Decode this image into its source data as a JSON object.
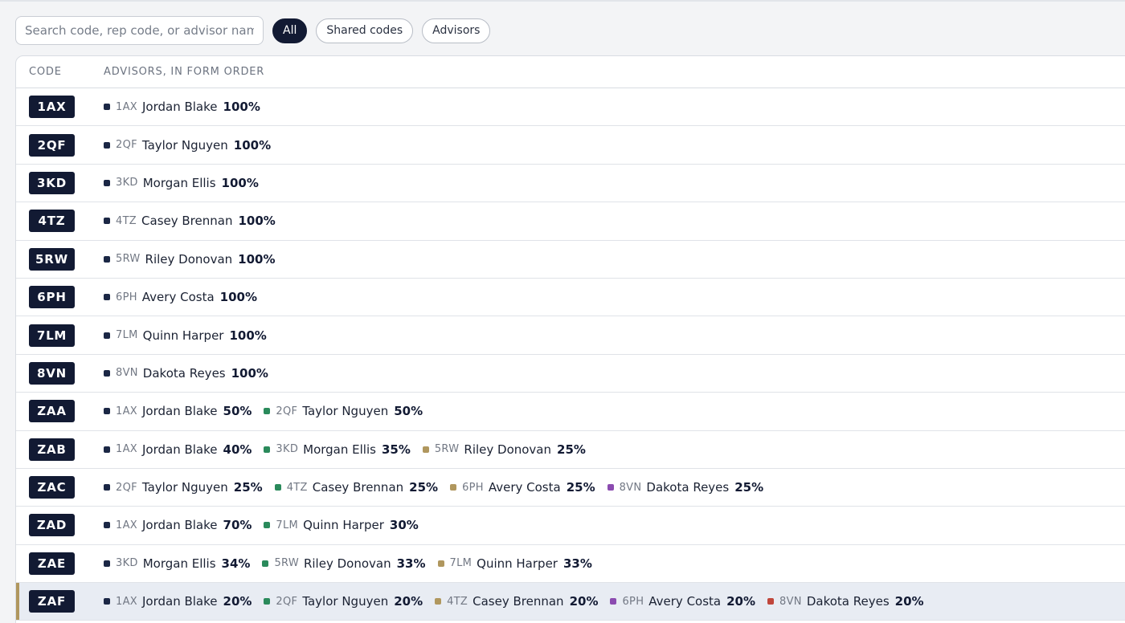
{
  "search": {
    "placeholder": "Search code, rep code, or advisor name"
  },
  "filters": [
    {
      "label": "All",
      "active": true
    },
    {
      "label": "Shared codes",
      "active": false
    },
    {
      "label": "Advisors",
      "active": false
    }
  ],
  "table": {
    "columns": [
      "CODE",
      "ADVISORS, IN FORM ORDER"
    ],
    "rows": [
      {
        "code": "1AX",
        "advisors": [
          {
            "rep": "1AX",
            "name": "Jordan Blake",
            "pct": "100%",
            "color": "#1b2745"
          }
        ]
      },
      {
        "code": "2QF",
        "advisors": [
          {
            "rep": "2QF",
            "name": "Taylor Nguyen",
            "pct": "100%",
            "color": "#1b2745"
          }
        ]
      },
      {
        "code": "3KD",
        "advisors": [
          {
            "rep": "3KD",
            "name": "Morgan Ellis",
            "pct": "100%",
            "color": "#1b2745"
          }
        ]
      },
      {
        "code": "4TZ",
        "advisors": [
          {
            "rep": "4TZ",
            "name": "Casey Brennan",
            "pct": "100%",
            "color": "#1b2745"
          }
        ]
      },
      {
        "code": "5RW",
        "advisors": [
          {
            "rep": "5RW",
            "name": "Riley Donovan",
            "pct": "100%",
            "color": "#1b2745"
          }
        ]
      },
      {
        "code": "6PH",
        "advisors": [
          {
            "rep": "6PH",
            "name": "Avery Costa",
            "pct": "100%",
            "color": "#1b2745"
          }
        ]
      },
      {
        "code": "7LM",
        "advisors": [
          {
            "rep": "7LM",
            "name": "Quinn Harper",
            "pct": "100%",
            "color": "#1b2745"
          }
        ]
      },
      {
        "code": "8VN",
        "advisors": [
          {
            "rep": "8VN",
            "name": "Dakota Reyes",
            "pct": "100%",
            "color": "#1b2745"
          }
        ]
      },
      {
        "code": "ZAA",
        "advisors": [
          {
            "rep": "1AX",
            "name": "Jordan Blake",
            "pct": "50%",
            "color": "#1b2745"
          },
          {
            "rep": "2QF",
            "name": "Taylor Nguyen",
            "pct": "50%",
            "color": "#2a8a5b"
          }
        ]
      },
      {
        "code": "ZAB",
        "advisors": [
          {
            "rep": "1AX",
            "name": "Jordan Blake",
            "pct": "40%",
            "color": "#1b2745"
          },
          {
            "rep": "3KD",
            "name": "Morgan Ellis",
            "pct": "35%",
            "color": "#2a8a5b"
          },
          {
            "rep": "5RW",
            "name": "Riley Donovan",
            "pct": "25%",
            "color": "#b0975e"
          }
        ]
      },
      {
        "code": "ZAC",
        "advisors": [
          {
            "rep": "2QF",
            "name": "Taylor Nguyen",
            "pct": "25%",
            "color": "#1b2745"
          },
          {
            "rep": "4TZ",
            "name": "Casey Brennan",
            "pct": "25%",
            "color": "#2a8a5b"
          },
          {
            "rep": "6PH",
            "name": "Avery Costa",
            "pct": "25%",
            "color": "#b0975e"
          },
          {
            "rep": "8VN",
            "name": "Dakota Reyes",
            "pct": "25%",
            "color": "#8b4bb0"
          }
        ]
      },
      {
        "code": "ZAD",
        "advisors": [
          {
            "rep": "1AX",
            "name": "Jordan Blake",
            "pct": "70%",
            "color": "#1b2745"
          },
          {
            "rep": "7LM",
            "name": "Quinn Harper",
            "pct": "30%",
            "color": "#2a8a5b"
          }
        ]
      },
      {
        "code": "ZAE",
        "advisors": [
          {
            "rep": "3KD",
            "name": "Morgan Ellis",
            "pct": "34%",
            "color": "#1b2745"
          },
          {
            "rep": "5RW",
            "name": "Riley Donovan",
            "pct": "33%",
            "color": "#2a8a5b"
          },
          {
            "rep": "7LM",
            "name": "Quinn Harper",
            "pct": "33%",
            "color": "#b0975e"
          }
        ]
      },
      {
        "code": "ZAF",
        "selected": true,
        "advisors": [
          {
            "rep": "1AX",
            "name": "Jordan Blake",
            "pct": "20%",
            "color": "#1b2745"
          },
          {
            "rep": "2QF",
            "name": "Taylor Nguyen",
            "pct": "20%",
            "color": "#2a8a5b"
          },
          {
            "rep": "4TZ",
            "name": "Casey Brennan",
            "pct": "20%",
            "color": "#b0975e"
          },
          {
            "rep": "6PH",
            "name": "Avery Costa",
            "pct": "20%",
            "color": "#8b4bb0"
          },
          {
            "rep": "8VN",
            "name": "Dakota Reyes",
            "pct": "20%",
            "color": "#c0463b"
          }
        ]
      }
    ]
  }
}
